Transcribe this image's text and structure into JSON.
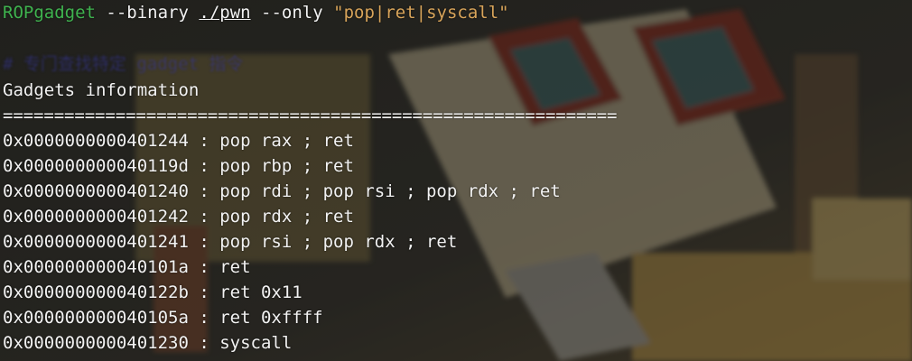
{
  "terminal": {
    "command": {
      "program": "ROPgadget",
      "flag_binary": "--binary",
      "path": "./pwn",
      "flag_only": "--only",
      "pattern": "\"pop|ret|syscall\""
    },
    "comment": "# 专门查找特定 gadget 指令",
    "heading": "Gadgets information",
    "separator": "============================================================",
    "gadgets": [
      "0x0000000000401244 : pop rax ; ret",
      "0x000000000040119d : pop rbp ; ret",
      "0x0000000000401240 : pop rdi ; pop rsi ; pop rdx ; ret",
      "0x0000000000401242 : pop rdx ; ret",
      "0x0000000000401241 : pop rsi ; pop rdx ; ret",
      "0x000000000040101a : ret",
      "0x000000000040122b : ret 0x11",
      "0x000000000040105a : ret 0xffff",
      "0x0000000000401230 : syscall"
    ]
  },
  "colors": {
    "program": "#3fb34f",
    "string": "#d8a45a",
    "text": "#f2f2f2",
    "background": "#2a2a25"
  }
}
